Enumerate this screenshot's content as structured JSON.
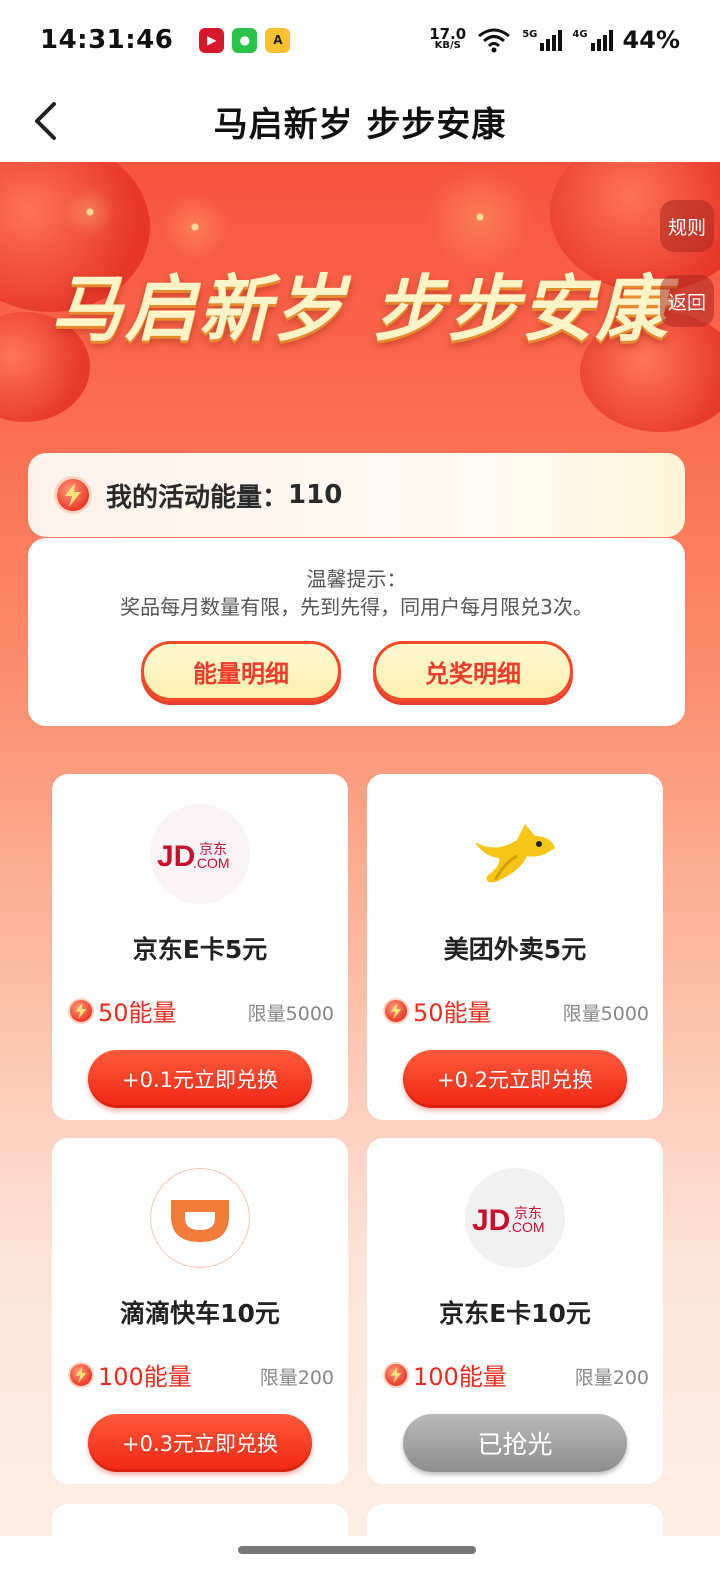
{
  "status_bar": {
    "time": "14:31:46",
    "net_speed_value": "17.0",
    "net_speed_unit": "KB/S",
    "sig1_tag": "5G",
    "sig2_tag": "4G",
    "battery": "44%"
  },
  "nav": {
    "title": "马启新岁 步步安康"
  },
  "banner": {
    "title": "马启新岁 步步安康",
    "rules_label": "规则",
    "return_label": "返回"
  },
  "energy": {
    "label": "我的活动能量：",
    "value": "110"
  },
  "tips": {
    "title": "温馨提示：",
    "text": "奖品每月数量有限，先到先得，同用户每月限兑3次。",
    "energy_detail_label": "能量明细",
    "prize_detail_label": "兑奖明细"
  },
  "prizes": [
    {
      "name": "京东E卡5元",
      "cost": "50能量",
      "limit": "限量5000",
      "action": "+0.1元立即兑换",
      "logo": "jd-logo"
    },
    {
      "name": "美团外卖5元",
      "cost": "50能量",
      "limit": "限量5000",
      "action": "+0.2元立即兑换",
      "logo": "meituan-kangaroo-logo"
    },
    {
      "name": "滴滴快车10元",
      "cost": "100能量",
      "limit": "限量200",
      "action": "+0.3元立即兑换",
      "logo": "didi-logo"
    },
    {
      "name": "京东E卡10元",
      "cost": "100能量",
      "limit": "限量200",
      "action": "已抢光",
      "logo": "jd-logo"
    }
  ],
  "colors": {
    "accent_red": "#ee2b1e",
    "banner_red": "#f8533d",
    "soldout_gray": "#9e9e9e",
    "didi_orange": "#f27c3a",
    "meituan_yellow": "#f5c518",
    "jd_red": "#c8102e"
  }
}
